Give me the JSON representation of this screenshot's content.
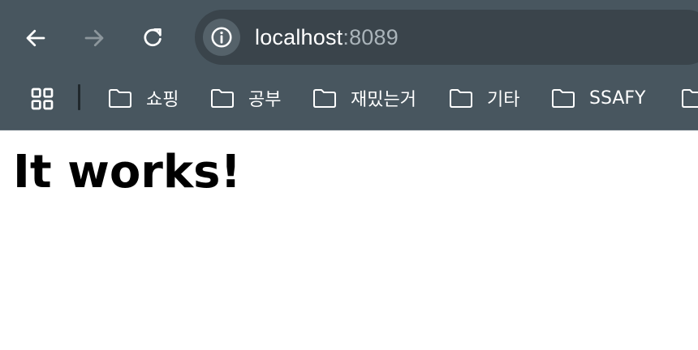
{
  "browser": {
    "nav": {
      "back_icon": "arrow-left-icon",
      "forward_icon": "arrow-right-icon",
      "reload_icon": "reload-icon"
    },
    "address_bar": {
      "site_info_icon": "info-circle-icon",
      "host": "localhost",
      "port": ":8089"
    },
    "bookmarks": {
      "apps_icon": "apps-grid-icon",
      "items": [
        {
          "label": "쇼핑",
          "icon": "folder-icon"
        },
        {
          "label": "공부",
          "icon": "folder-icon"
        },
        {
          "label": "재밌는거",
          "icon": "folder-icon"
        },
        {
          "label": "기타",
          "icon": "folder-icon"
        },
        {
          "label": "SSAFY",
          "icon": "folder-icon"
        },
        {
          "label": "",
          "icon": "folder-icon"
        }
      ]
    },
    "colors": {
      "chrome_bg": "#48565f",
      "omnibox_bg": "#3a444b",
      "port_text": "#aab4ba",
      "disabled_icon": "#8c969c"
    }
  },
  "page": {
    "heading": "It works!"
  }
}
